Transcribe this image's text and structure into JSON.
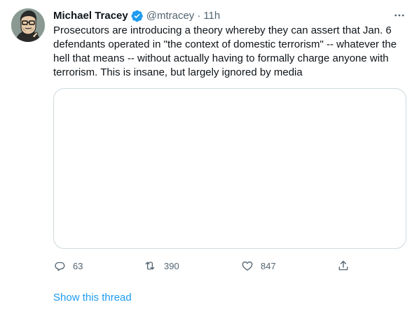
{
  "tweet": {
    "author": {
      "name": "Michael Tracey",
      "handle": "@mtracey",
      "verified": true,
      "avatar_icon": "cartoon-portrait-avatar"
    },
    "separator": "·",
    "time": "11h",
    "text_lines": [
      "Prosecutors are introducing a theory whereby they can assert that Jan. 6",
      "defendants operated in \"the context of domestic terrorism\" -- whatever the",
      "hell that means -- without actually having to formally charge anyone with",
      "terrorism. This is insane, but largely ignored by media"
    ],
    "actions": {
      "reply_count": "63",
      "retweet_count": "390",
      "like_count": "847"
    },
    "show_thread": "Show this thread"
  },
  "colors": {
    "text_primary": "#0f1419",
    "text_secondary": "#536471",
    "accent": "#1d9bf0",
    "border": "#cfd9de"
  }
}
